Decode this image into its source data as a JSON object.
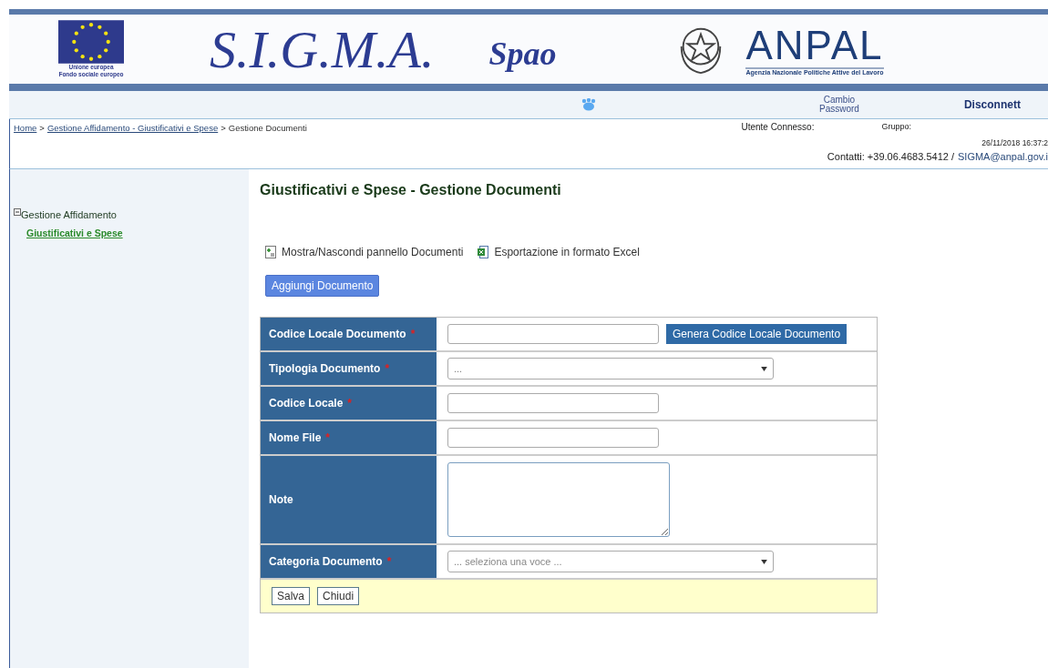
{
  "header": {
    "eu_caption": [
      "Unione europea",
      "Fondo sociale europeo"
    ],
    "title": "S.I.G.M.A.",
    "subtitle": "Spao",
    "agency_logo": "ANPAL",
    "agency_caption": "Agenzia Nazionale Politiche Attive del Lavoro"
  },
  "nav": {
    "change_password": [
      "Cambio",
      "Password"
    ],
    "logout": "Disconnett"
  },
  "breadcrumb": [
    {
      "label": "Home",
      "link": true
    },
    {
      "separator": ">",
      "label": "Gestione Affidamento - Giustificativi e Spese",
      "link": true
    },
    {
      "separator": ">",
      "label": "Gestione Documenti",
      "link": false
    }
  ],
  "user_info": {
    "user_label": "Utente Connesso:",
    "group_label": "Gruppo:",
    "datetime": "26/11/2018 16:37:2",
    "contacts_label": "Contatti: +39.06.4683.5412 /",
    "email": "SIGMA@anpal.gov.i"
  },
  "sidebar": {
    "items": [
      {
        "label": "Gestione Affidamento",
        "expanded": true,
        "children": [
          {
            "label": "Giustificativi e Spese",
            "selected": true
          }
        ]
      }
    ]
  },
  "page_title": "Giustificativi e Spese - Gestione Documenti",
  "toolbar": [
    {
      "kind": "panel",
      "label": "Mostra/Nascondi pannello Documenti"
    },
    {
      "kind": "excel",
      "label": "Esportazione in formato Excel"
    }
  ],
  "add_button": "Aggiungi Documento",
  "form": {
    "rows": [
      {
        "kind": "text",
        "label": "Codice Locale Documento",
        "required_mark": "*",
        "button": "Genera Codice Locale Documento"
      },
      {
        "kind": "select",
        "label": "Tipologia Documento",
        "required_mark": "*",
        "value": "..."
      },
      {
        "kind": "text",
        "label": "Codice Locale",
        "required_mark": "*"
      },
      {
        "kind": "text",
        "label": "Nome File",
        "required_mark": "*"
      },
      {
        "kind": "textarea",
        "label": "Note"
      },
      {
        "kind": "select",
        "label": "Categoria Documento",
        "required_mark": "*",
        "value": "... seleziona una voce ..."
      }
    ],
    "buttons": [
      "Salva",
      "Chiudi"
    ]
  }
}
